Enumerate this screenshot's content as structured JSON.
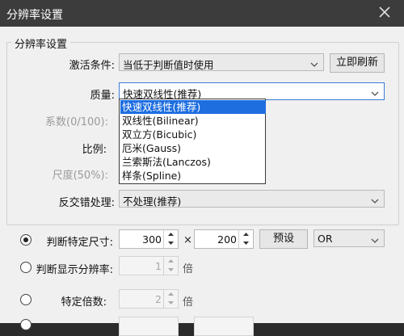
{
  "window": {
    "title": "分辨率设置"
  },
  "group": {
    "title": "分辨率设置"
  },
  "activation": {
    "label": "激活条件:",
    "value": "当低于判断值时使用",
    "refresh_button": "立即刷新"
  },
  "quality": {
    "label": "质量:",
    "value": "快速双线性(推荐)",
    "options": [
      "快速双线性(推荐)",
      "双线性(Bilinear)",
      "双立方(Bicubic)",
      "厄米(Gauss)",
      "兰索斯法(Lanczos)",
      "样条(Spline)"
    ],
    "selected_index": 0
  },
  "coefficient": {
    "label": "系数(0/100):"
  },
  "ratio": {
    "label": "比例:"
  },
  "scale": {
    "label": "尺度(50%):"
  },
  "antialias": {
    "label": "反交错处理:",
    "value": "不处理(推荐)"
  },
  "specific_size": {
    "label": "判断特定尺寸:",
    "width": "300",
    "times_sign": "×",
    "height": "200",
    "preset_button": "预设",
    "logic": "OR",
    "checked": true
  },
  "display_res": {
    "label": "判断显示分辨率:",
    "value": "1",
    "unit": "倍",
    "checked": false
  },
  "specific_multiple": {
    "label": "特定倍数:",
    "value": "2",
    "unit": "倍",
    "checked": false
  },
  "colors": {
    "titlebar": "#3c3c3c",
    "selection": "#1e6ee0",
    "dialog_bg": "#f0f0f0"
  }
}
